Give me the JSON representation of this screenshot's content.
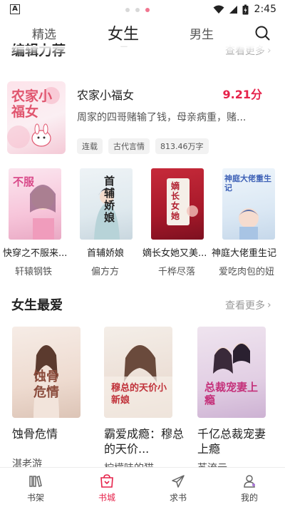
{
  "status_bar": {
    "time": "2:45"
  },
  "top_tabs": [
    {
      "label": "精选",
      "active": false
    },
    {
      "label": "女生",
      "active": true
    },
    {
      "label": "男生",
      "active": false
    }
  ],
  "editor_section": {
    "title": "编辑力荐",
    "more": "查看更多"
  },
  "featured": {
    "title": "农家小福女",
    "score": "9.21分",
    "description": "周家的四哥赌输了钱，母亲病重，赌...",
    "cover_text": "农家小福女",
    "tags": [
      "连载",
      "古代言情",
      "813.46万字"
    ]
  },
  "book_row": [
    {
      "title": "快穿之不服来...",
      "author": "轩辕钢铁",
      "cover_text": "不服"
    },
    {
      "title": "首辅娇娘",
      "author": "偏方方",
      "cover_text": "首辅娇娘"
    },
    {
      "title": "嫡长女她又美...",
      "author": "千桦尽落",
      "cover_text": "嫡长女她"
    },
    {
      "title": "神庭大佬重生记",
      "author": "爱吃肉包的妞",
      "cover_text": "神庭大佬重生记"
    }
  ],
  "fav_section": {
    "title": "女生最爱",
    "more": "查看更多"
  },
  "fav_books": [
    {
      "title": "蚀骨危情",
      "author": "湛老游",
      "cover_text": "蚀骨危情"
    },
    {
      "title": "霸爱成瘾：穆总的天价...",
      "author": "柠檬味的猫",
      "cover_text": "穆总的天价小新娘"
    },
    {
      "title": "千亿总裁宠妻上瘾",
      "author": "苏流云",
      "cover_text": "总裁宠妻上瘾"
    }
  ],
  "bottom_nav": [
    {
      "label": "书架",
      "icon": "bookshelf-icon",
      "active": false
    },
    {
      "label": "书城",
      "icon": "bookstore-icon",
      "active": true
    },
    {
      "label": "求书",
      "icon": "paper-plane-icon",
      "active": false
    },
    {
      "label": "我的",
      "icon": "profile-icon",
      "active": false
    }
  ],
  "colors": {
    "accent": "#e6224a",
    "indicator": "#f0758f"
  }
}
